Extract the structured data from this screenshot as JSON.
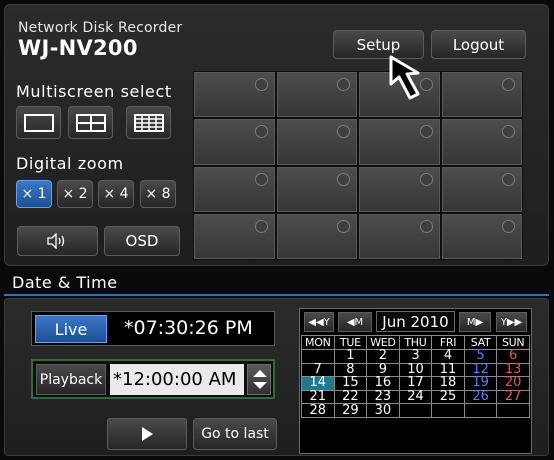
{
  "header": {
    "brand_line1": "Network Disk Recorder",
    "brand_line2": "WJ-NV200",
    "setup_label": "Setup",
    "logout_label": "Logout"
  },
  "multiscreen": {
    "label": "Multiscreen select",
    "options": [
      "1-screen",
      "4-screen",
      "16-screen"
    ]
  },
  "zoom": {
    "label": "Digital zoom",
    "options": [
      "× 1",
      "× 2",
      "× 4",
      "× 8"
    ],
    "selected": "× 1"
  },
  "audio_icon": "speaker-icon",
  "osd_label": "OSD",
  "camera_grid": {
    "rows": 4,
    "cols": 4
  },
  "datetime": {
    "title": "Date & Time",
    "live_label": "Live",
    "live_time": "*07:30:26 PM",
    "playback_label": "Playback",
    "playback_time": "*12:00:00 AM",
    "play_icon": "play-icon",
    "go_to_last_label": "Go to last"
  },
  "calendar": {
    "nav": {
      "prev_year": "◀◀Y",
      "prev_month": "◀M",
      "next_month": "M▶",
      "next_year": "Y▶▶"
    },
    "month": "Jun 2010",
    "weekdays": [
      "MON",
      "TUE",
      "WED",
      "THU",
      "FRI",
      "SAT",
      "SUN"
    ],
    "weeks": [
      [
        "",
        "1",
        "2",
        "3",
        "4",
        "5",
        "6"
      ],
      [
        "7",
        "8",
        "9",
        "10",
        "11",
        "12",
        "13"
      ],
      [
        "14",
        "15",
        "16",
        "17",
        "18",
        "19",
        "20"
      ],
      [
        "21",
        "22",
        "23",
        "24",
        "25",
        "26",
        "27"
      ],
      [
        "28",
        "29",
        "30",
        "",
        "",
        "",
        ""
      ]
    ],
    "today": "14",
    "colors": {
      "saturday": "#5a7ef0",
      "sunday": "#e05a5a",
      "today_bg": "#1f7a8c"
    }
  }
}
